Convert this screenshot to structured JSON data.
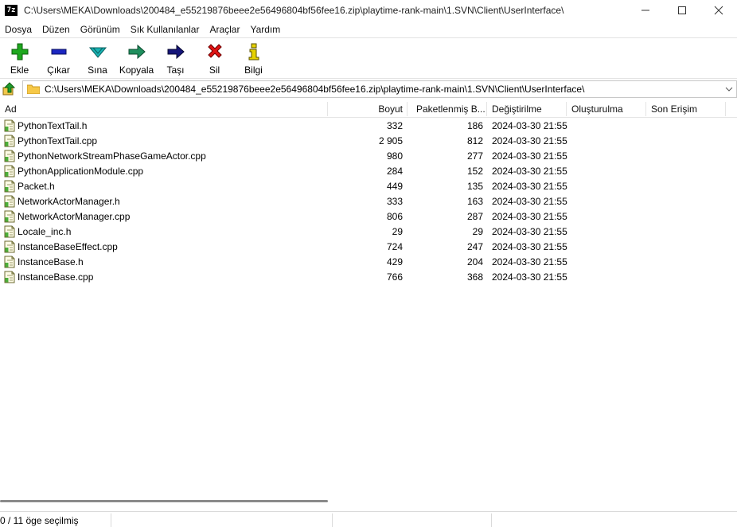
{
  "window": {
    "title": "C:\\Users\\MEKA\\Downloads\\200484_e55219876beee2e56496804bf56fee16.zip\\playtime-rank-main\\1.SVN\\Client\\UserInterface\\",
    "app_icon_text": "7z",
    "controls": [
      "minimize-icon",
      "maximize-icon",
      "close-icon"
    ]
  },
  "menu": [
    "Dosya",
    "Düzen",
    "Görünüm",
    "Sık Kullanılanlar",
    "Araçlar",
    "Yardım"
  ],
  "toolbar": [
    {
      "label": "Ekle",
      "icon": "add-icon",
      "color": "#1ea81e"
    },
    {
      "label": "Çıkar",
      "icon": "extract-icon",
      "color": "#1b26c2"
    },
    {
      "label": "Sına",
      "icon": "test-icon",
      "color": "#18b3b3"
    },
    {
      "label": "Kopyala",
      "icon": "copy-icon",
      "color": "#1f8f5e"
    },
    {
      "label": "Taşı",
      "icon": "move-icon",
      "color": "#15157a"
    },
    {
      "label": "Sil",
      "icon": "delete-icon",
      "color": "#e01414"
    },
    {
      "label": "Bilgi",
      "icon": "info-icon",
      "color": "#e6d200"
    }
  ],
  "address": {
    "path": "C:\\Users\\MEKA\\Downloads\\200484_e55219876beee2e56496804bf56fee16.zip\\playtime-rank-main\\1.SVN\\Client\\UserInterface\\"
  },
  "columns": {
    "name": "Ad",
    "size": "Boyut",
    "packed": "Paketlenmiş B...",
    "modified": "Değiştirilme",
    "created": "Oluşturulma",
    "accessed": "Son Erişim"
  },
  "files": [
    {
      "name": "PythonTextTail.h",
      "size": "332",
      "packed": "186",
      "modified": "2024-03-30 21:55"
    },
    {
      "name": "PythonTextTail.cpp",
      "size": "2 905",
      "packed": "812",
      "modified": "2024-03-30 21:55"
    },
    {
      "name": "PythonNetworkStreamPhaseGameActor.cpp",
      "size": "980",
      "packed": "277",
      "modified": "2024-03-30 21:55"
    },
    {
      "name": "PythonApplicationModule.cpp",
      "size": "284",
      "packed": "152",
      "modified": "2024-03-30 21:55"
    },
    {
      "name": "Packet.h",
      "size": "449",
      "packed": "135",
      "modified": "2024-03-30 21:55"
    },
    {
      "name": "NetworkActorManager.h",
      "size": "333",
      "packed": "163",
      "modified": "2024-03-30 21:55"
    },
    {
      "name": "NetworkActorManager.cpp",
      "size": "806",
      "packed": "287",
      "modified": "2024-03-30 21:55"
    },
    {
      "name": "Locale_inc.h",
      "size": "29",
      "packed": "29",
      "modified": "2024-03-30 21:55"
    },
    {
      "name": "InstanceBaseEffect.cpp",
      "size": "724",
      "packed": "247",
      "modified": "2024-03-30 21:55"
    },
    {
      "name": "InstanceBase.h",
      "size": "429",
      "packed": "204",
      "modified": "2024-03-30 21:55"
    },
    {
      "name": "InstanceBase.cpp",
      "size": "766",
      "packed": "368",
      "modified": "2024-03-30 21:55"
    }
  ],
  "status": {
    "selection": "0 / 11 öge seçilmiş"
  }
}
